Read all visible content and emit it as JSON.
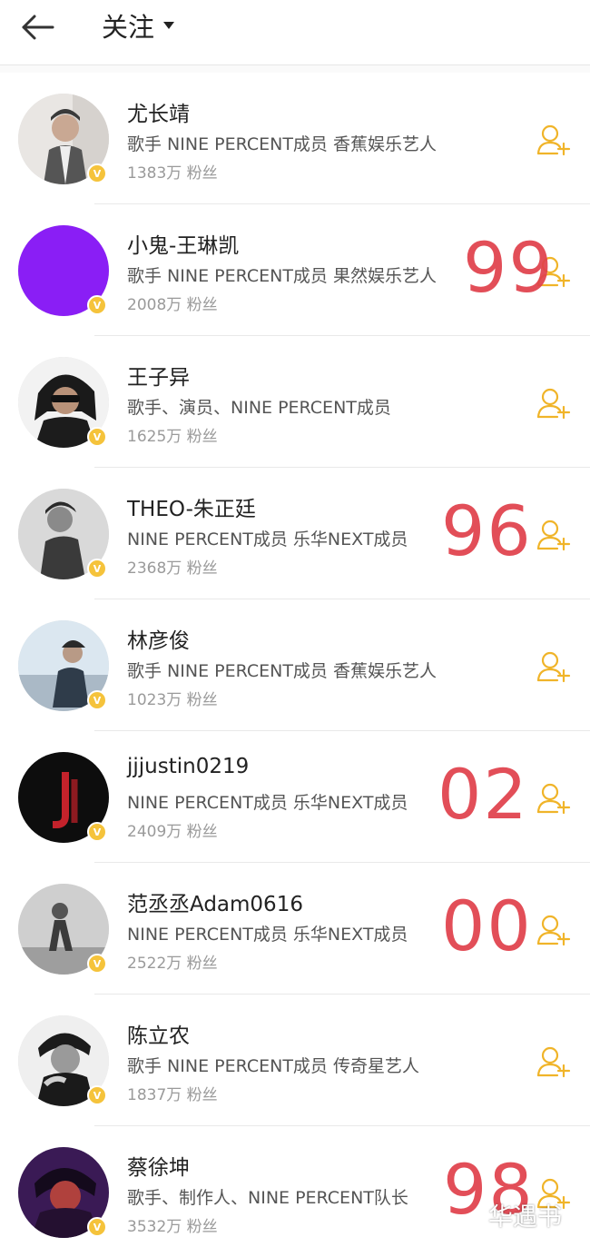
{
  "header": {
    "title": "关注"
  },
  "users": [
    {
      "name": "尤长靖",
      "desc": "歌手 NINE PERCENT成员 香蕉娱乐艺人",
      "fans": "1383万 粉丝",
      "overlay": ""
    },
    {
      "name": "小鬼-王琳凯",
      "desc": "歌手 NINE PERCENT成员 果然娱乐艺人",
      "fans": "2008万 粉丝",
      "overlay": "99"
    },
    {
      "name": "王子异",
      "desc": "歌手、演员、NINE PERCENT成员",
      "fans": "1625万 粉丝",
      "overlay": ""
    },
    {
      "name": "THEO-朱正廷",
      "desc": "NINE PERCENT成员 乐华NEXT成员",
      "fans": "2368万 粉丝",
      "overlay": "96"
    },
    {
      "name": "林彦俊",
      "desc": "歌手 NINE PERCENT成员 香蕉娱乐艺人",
      "fans": "1023万 粉丝",
      "overlay": ""
    },
    {
      "name": "jjjustin0219",
      "desc": "NINE PERCENT成员 乐华NEXT成员",
      "fans": "2409万 粉丝",
      "overlay": "02"
    },
    {
      "name": "范丞丞Adam0616",
      "desc": "NINE PERCENT成员 乐华NEXT成员",
      "fans": "2522万 粉丝",
      "overlay": "00"
    },
    {
      "name": "陈立农",
      "desc": "歌手 NINE PERCENT成员 传奇星艺人",
      "fans": "1837万 粉丝",
      "overlay": ""
    },
    {
      "name": "蔡徐坤",
      "desc": "歌手、制作人、NINE PERCENT队长",
      "fans": "3532万 粉丝",
      "overlay": "98"
    }
  ],
  "watermark": "华遇书",
  "colors": {
    "follow_icon": "#f0b429",
    "verified_badge": "#f5c33b",
    "overlay_number": "#e0404a"
  },
  "icons": {
    "back": "arrow-left-icon",
    "dropdown": "caret-down-icon",
    "follow": "add-user-icon",
    "verified": "verified-v-icon"
  }
}
